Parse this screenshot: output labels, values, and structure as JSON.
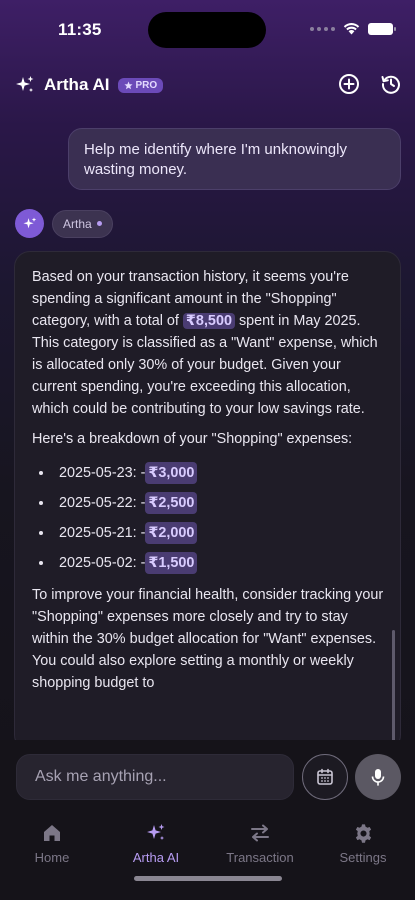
{
  "status_bar": {
    "time": "11:35"
  },
  "header": {
    "title": "Artha AI",
    "badge": "PRO",
    "new_chat_icon": "plus-circle-icon",
    "history_icon": "history-icon"
  },
  "user_message": {
    "text": "Help me identify where I'm unknowingly wasting money."
  },
  "assistant": {
    "chip_label": "Artha",
    "paragraph1": {
      "before": "Based on your transaction history, it seems you're spending a significant amount in the \"Shopping\" category, with a total of ",
      "amount": "₹8,500",
      "after": " spent in May 2025. This category is classified as a \"Want\" expense, which is allocated only 30% of your budget. Given your current spending, you're exceeding this allocation, which could be contributing to your low savings rate."
    },
    "paragraph2": "Here's a breakdown of your \"Shopping\" expenses:",
    "expenses": [
      {
        "date": "2025-05-23: -",
        "amount": "₹3,000"
      },
      {
        "date": "2025-05-22: -",
        "amount": "₹2,500"
      },
      {
        "date": "2025-05-21: -",
        "amount": "₹2,000"
      },
      {
        "date": "2025-05-02: -",
        "amount": "₹1,500"
      }
    ],
    "paragraph3": "To improve your financial health, consider tracking your \"Shopping\" expenses more closely and try to stay within the 30% budget allocation for \"Want\" expenses. You could also explore setting a monthly or weekly shopping budget to"
  },
  "input": {
    "placeholder": "Ask me anything..."
  },
  "nav": {
    "items": [
      {
        "label": "Home",
        "icon": "home-icon"
      },
      {
        "label": "Artha AI",
        "icon": "sparkles-icon"
      },
      {
        "label": "Transaction",
        "icon": "transfer-arrows-icon"
      },
      {
        "label": "Settings",
        "icon": "gear-icon"
      }
    ],
    "active": "Artha AI"
  },
  "colors": {
    "accent": "#b79cf2",
    "badge_bg": "#6b4ab8",
    "highlight_bg": "#4a3c72",
    "avatar_bg": "#7e5ad6"
  }
}
